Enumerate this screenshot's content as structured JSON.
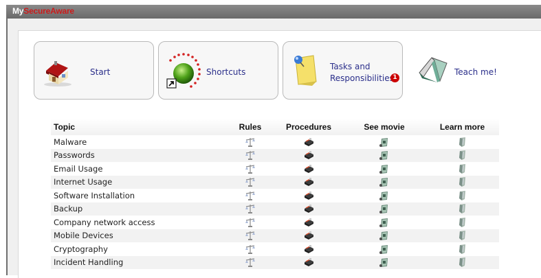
{
  "window": {
    "title_prefix": "My",
    "title_brand": "SecureAware"
  },
  "tiles": [
    {
      "key": "start",
      "label": "Start",
      "icon": "house-icon"
    },
    {
      "key": "shortcuts",
      "label": "Shortcuts",
      "icon": "green-orb-shortcut-icon"
    },
    {
      "key": "tasks",
      "label_line1": "Tasks and",
      "label_line2": "Responsibilities",
      "badge": "1",
      "icon": "sticky-note-pin-icon"
    },
    {
      "key": "teach",
      "label": "Teach me!",
      "icon": "open-book-icon"
    }
  ],
  "table": {
    "headers": {
      "topic": "Topic",
      "rules": "Rules",
      "procedures": "Procedures",
      "movie": "See movie",
      "learn": "Learn more"
    },
    "rows": [
      "Malware",
      "Passwords",
      "Email Usage",
      "Internet Usage",
      "Software Installation",
      "Backup",
      "Company network access",
      "Mobile Devices",
      "Cryptography",
      "Incident Handling"
    ],
    "column_icons": {
      "rules": "rules-scale-icon",
      "procedures": "procedures-book-icon",
      "movie": "movie-film-icon",
      "learn": "learn-more-bookmark-icon"
    }
  },
  "colors": {
    "brand_red": "#cc1b1b",
    "link_blue": "#2a2e8a",
    "badge_red": "#cc0000",
    "titlebar_gray": "#7a7a7a"
  }
}
